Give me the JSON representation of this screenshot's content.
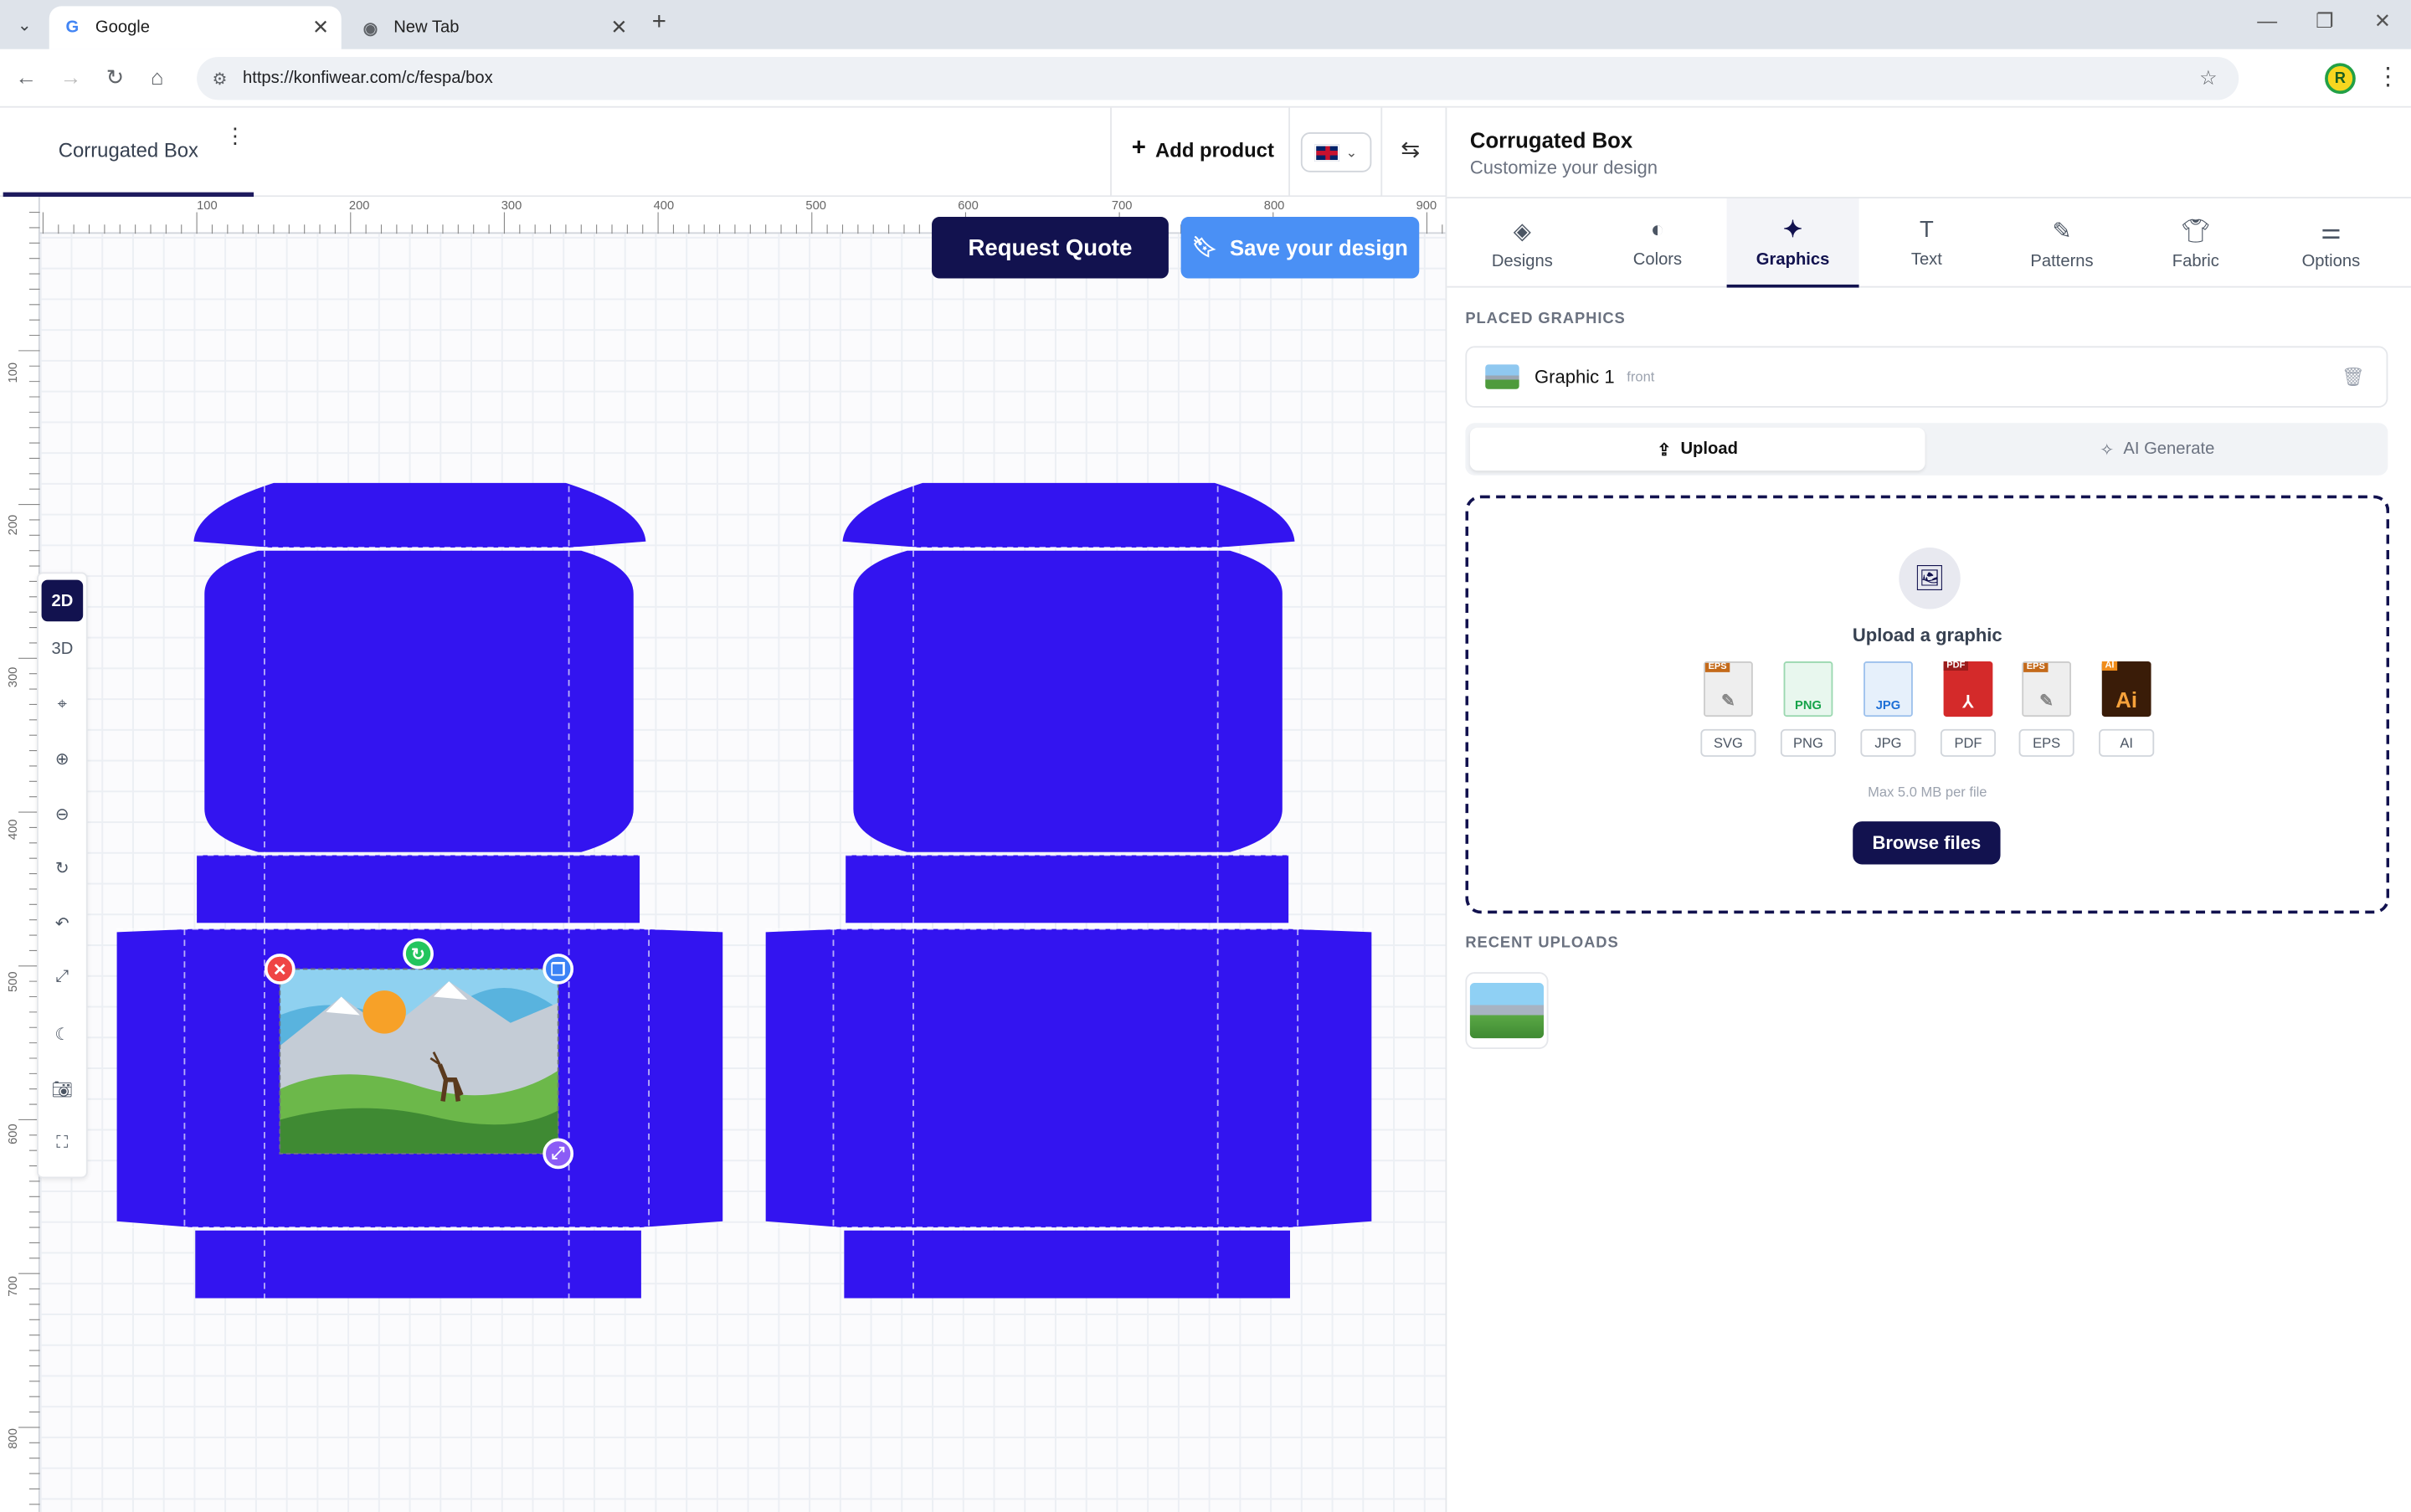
{
  "browser": {
    "tabs": [
      {
        "title": "Google",
        "icon": "google-favicon",
        "active": true
      },
      {
        "title": "New Tab",
        "icon": "chrome-favicon",
        "active": false
      }
    ],
    "url": "https://konfiwear.com/c/fespa/box"
  },
  "header": {
    "product_tab": "Corrugated Box",
    "add_product": "Add product"
  },
  "canvas": {
    "ruler_top": [
      "100",
      "200",
      "300",
      "400",
      "500",
      "600",
      "700",
      "800",
      "900"
    ],
    "ruler_left": [
      "100",
      "200",
      "300",
      "400",
      "500",
      "600",
      "700",
      "800"
    ],
    "request_quote": "Request Quote",
    "save_design": "Save your design",
    "view_2d": "2D",
    "view_3d": "3D",
    "box_color": "#3314F0"
  },
  "panel": {
    "title": "Corrugated Box",
    "subtitle": "Customize your design",
    "tabs": [
      {
        "label": "Designs",
        "icon": "layers-icon"
      },
      {
        "label": "Colors",
        "icon": "palette-icon"
      },
      {
        "label": "Graphics",
        "icon": "sparkles-icon"
      },
      {
        "label": "Text",
        "icon": "text-icon"
      },
      {
        "label": "Patterns",
        "icon": "brush-icon"
      },
      {
        "label": "Fabric",
        "icon": "shirt-icon"
      },
      {
        "label": "Options",
        "icon": "sliders-icon"
      }
    ],
    "placed_label": "PLACED GRAPHICS",
    "placed_item": {
      "name": "Graphic 1",
      "side": "front"
    },
    "upload_tab": "Upload",
    "ai_tab": "AI Generate",
    "upload_title": "Upload a graphic",
    "formats": [
      "SVG",
      "PNG",
      "JPG",
      "PDF",
      "EPS",
      "AI"
    ],
    "max_note": "Max 5.0 MB per file",
    "browse": "Browse files",
    "recent_label": "RECENT UPLOADS"
  },
  "colors": {
    "navy": "#12124F",
    "accent_blue": "#4A90F5",
    "box_blue": "#3314F0"
  }
}
